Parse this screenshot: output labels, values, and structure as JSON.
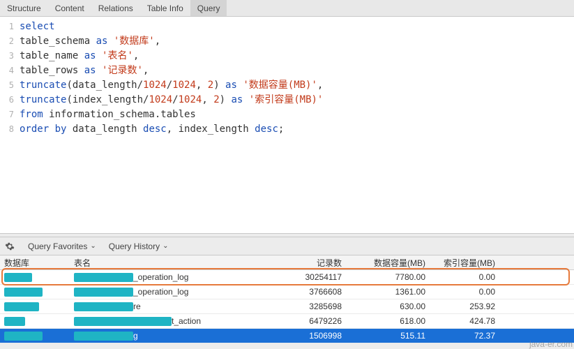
{
  "tabs": {
    "items": [
      "Structure",
      "Content",
      "Relations",
      "Table Info",
      "Query"
    ],
    "active": 4
  },
  "sql": {
    "lines": [
      [
        {
          "t": "kw",
          "v": "select"
        }
      ],
      [
        {
          "t": "",
          "v": "table_schema "
        },
        {
          "t": "kw",
          "v": "as"
        },
        {
          "t": "",
          "v": " "
        },
        {
          "t": "str",
          "v": "'数据库'"
        },
        {
          "t": "",
          "v": ","
        }
      ],
      [
        {
          "t": "",
          "v": "table_name "
        },
        {
          "t": "kw",
          "v": "as"
        },
        {
          "t": "",
          "v": " "
        },
        {
          "t": "str",
          "v": "'表名'"
        },
        {
          "t": "",
          "v": ","
        }
      ],
      [
        {
          "t": "",
          "v": "table_rows "
        },
        {
          "t": "kw",
          "v": "as"
        },
        {
          "t": "",
          "v": " "
        },
        {
          "t": "str",
          "v": "'记录数'"
        },
        {
          "t": "",
          "v": ","
        }
      ],
      [
        {
          "t": "kw",
          "v": "truncate"
        },
        {
          "t": "",
          "v": "(data_length/"
        },
        {
          "t": "num",
          "v": "1024"
        },
        {
          "t": "",
          "v": "/"
        },
        {
          "t": "num",
          "v": "1024"
        },
        {
          "t": "",
          "v": ", "
        },
        {
          "t": "num",
          "v": "2"
        },
        {
          "t": "",
          "v": ") "
        },
        {
          "t": "kw",
          "v": "as"
        },
        {
          "t": "",
          "v": " "
        },
        {
          "t": "str",
          "v": "'数据容量(MB)'"
        },
        {
          "t": "",
          "v": ","
        }
      ],
      [
        {
          "t": "kw",
          "v": "truncate"
        },
        {
          "t": "",
          "v": "(index_length/"
        },
        {
          "t": "num",
          "v": "1024"
        },
        {
          "t": "",
          "v": "/"
        },
        {
          "t": "num",
          "v": "1024"
        },
        {
          "t": "",
          "v": ", "
        },
        {
          "t": "num",
          "v": "2"
        },
        {
          "t": "",
          "v": ") "
        },
        {
          "t": "kw",
          "v": "as"
        },
        {
          "t": "",
          "v": " "
        },
        {
          "t": "str",
          "v": "'索引容量(MB)'"
        }
      ],
      [
        {
          "t": "kw",
          "v": "from"
        },
        {
          "t": "",
          "v": " information_schema.tables"
        }
      ],
      [
        {
          "t": "kw",
          "v": "order by"
        },
        {
          "t": "",
          "v": " data_length "
        },
        {
          "t": "kw",
          "v": "desc"
        },
        {
          "t": "",
          "v": ", index_length "
        },
        {
          "t": "kw",
          "v": "desc"
        },
        {
          "t": "",
          "v": ";"
        }
      ]
    ]
  },
  "toolbar": {
    "favorites": "Query Favorites",
    "history": "Query History"
  },
  "columns": {
    "c1": "数据库",
    "c2": "表名",
    "c3": "记录数",
    "c4": "数据容量(MB)",
    "c5": "索引容量(MB)"
  },
  "rows": [
    {
      "db_redact_w": 40,
      "tbl_prefix_w": 85,
      "tbl_suffix": "_operation_log",
      "rows": "30254117",
      "data": "7780.00",
      "idx": "0.00",
      "highlighted": true
    },
    {
      "db_redact_w": 55,
      "tbl_prefix_w": 85,
      "tbl_suffix": "_operation_log",
      "rows": "3766608",
      "data": "1361.00",
      "idx": "0.00"
    },
    {
      "db_redact_w": 50,
      "tbl_prefix_w": 85,
      "tbl_suffix": "re",
      "rows": "3285698",
      "data": "630.00",
      "idx": "253.92"
    },
    {
      "db_redact_w": 30,
      "tbl_prefix_w": 140,
      "tbl_suffix": "t_action",
      "rows": "6479226",
      "data": "618.00",
      "idx": "424.78"
    },
    {
      "db_redact_w": 55,
      "tbl_prefix_w": 85,
      "tbl_suffix": "g",
      "rows": "1506998",
      "data": "515.11",
      "idx": "72.37",
      "selected": true
    }
  ],
  "watermark": "java-er.com"
}
